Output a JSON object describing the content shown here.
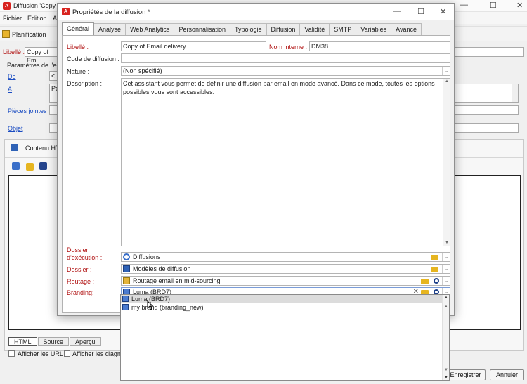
{
  "background_window": {
    "title": "Diffusion 'Copy o",
    "menu": [
      "Fichier",
      "Edition",
      "A"
    ],
    "toolbar_planification": "Planification",
    "libelle_label": "Libellé :",
    "libelle_value": "Copy of Em",
    "params_title": "Paramètres de l'e-m",
    "de_link": "De",
    "de_value": "<",
    "a_link": "A",
    "a_value": "Po",
    "pieces_link": "Pièces jointes",
    "objet_link": "Objet",
    "content_title": "Contenu HT",
    "bottom_tabs": [
      "HTML",
      "Source",
      "Aperçu"
    ],
    "afficher_url": "Afficher les URL",
    "afficher_diag": "Afficher les diagno",
    "btn_enregistrer": "Enregistrer",
    "btn_annuler": "Annuler"
  },
  "dialog": {
    "title": "Propriétés de la diffusion *",
    "controls": {
      "minimize": "—",
      "maximize": "☐",
      "close": "✕"
    },
    "tabs": [
      "Général",
      "Analyse",
      "Web Analytics",
      "Personnalisation",
      "Typologie",
      "Diffusion",
      "Validité",
      "SMTP",
      "Variables",
      "Avancé"
    ],
    "active_tab": "Général",
    "libelle_label": "Libellé :",
    "libelle_value": "Copy of Email delivery",
    "nom_interne_label": "Nom interne :",
    "nom_interne_value": "DM38",
    "code_label": "Code de diffusion :",
    "code_value": "",
    "nature_label": "Nature :",
    "nature_value": "(Non spécifié)",
    "description_label": "Description :",
    "description_value": "Cet assistant vous permet de définir une diffusion par email en mode avancé. Dans ce mode, toutes les options possibles vous sont accessibles.",
    "dossier_exec_label_1": "Dossier",
    "dossier_exec_label_2": "d'exécution :",
    "dossier_exec_value": "Diffusions",
    "dossier_label": "Dossier :",
    "dossier_value": "Modèles de diffusion",
    "routage_label": "Routage :",
    "routage_value": "Routage email en mid-sourcing",
    "branding_label": "Branding:",
    "branding_value": "Luma (BRD7)",
    "branding_options": [
      "Luma (BRD7)",
      "my brand (branding_new)"
    ]
  },
  "colors": {
    "accent_red": "#d8231f",
    "label_red": "#b01010",
    "link_blue": "#1a4cc2",
    "icon_blue": "#2f62b6",
    "folder_yellow": "#e6b520"
  }
}
